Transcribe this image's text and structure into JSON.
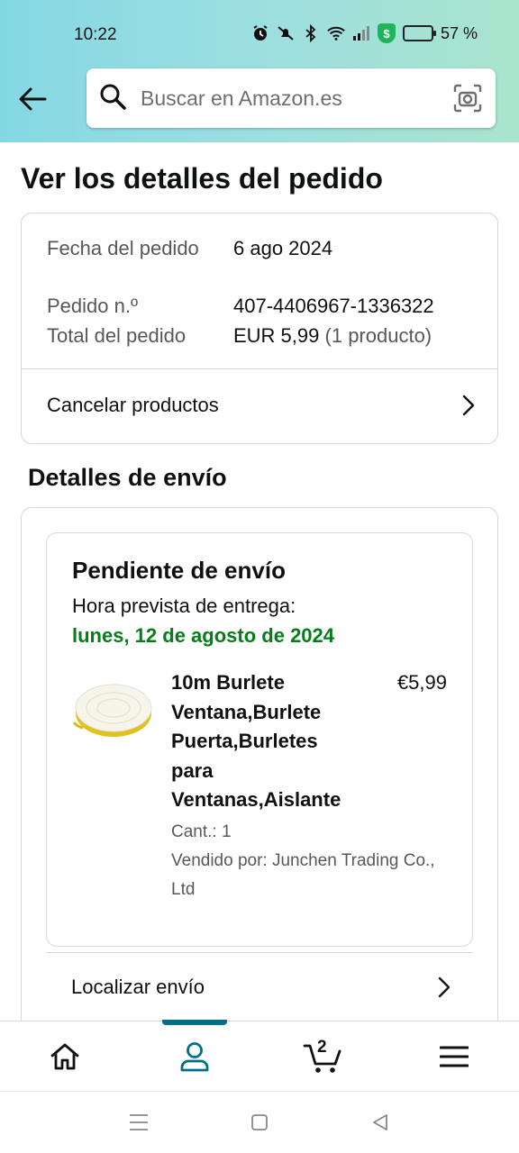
{
  "status_bar": {
    "time": "10:22",
    "battery_percent": "57 %",
    "battery_level": 0.57
  },
  "search": {
    "placeholder": "Buscar en Amazon.es"
  },
  "page": {
    "title": "Ver los detalles del pedido"
  },
  "order_summary": {
    "rows": [
      {
        "label": "Fecha del pedido",
        "value": "6 ago 2024"
      },
      {
        "label": "Pedido n.º",
        "value": "407-4406967-1336322"
      },
      {
        "label": "Total del pedido",
        "value": "EUR 5,99",
        "value_extra": "(1 producto)"
      }
    ],
    "cancel_label": "Cancelar productos"
  },
  "shipping": {
    "section_title": "Detalles de envío",
    "status": "Pendiente de envío",
    "eta_label": "Hora prevista de entrega:",
    "eta_date": "lunes, 12 de agosto de 2024",
    "product": {
      "title": "10m Burlete Ventana,Burlete Puerta,Burletes para Ventanas,Aislante",
      "price": "€5,99",
      "quantity": "Cant.: 1",
      "seller": "Vendido por: Junchen Trading Co., Ltd"
    },
    "track_label": "Localizar envío"
  },
  "bottom_nav": {
    "items": [
      {
        "icon": "home-icon"
      },
      {
        "icon": "account-icon",
        "active": true
      },
      {
        "icon": "cart-icon",
        "count": "2"
      },
      {
        "icon": "menu-icon"
      }
    ]
  },
  "colors": {
    "accent": "#007185",
    "delivery_green": "#067d18"
  }
}
